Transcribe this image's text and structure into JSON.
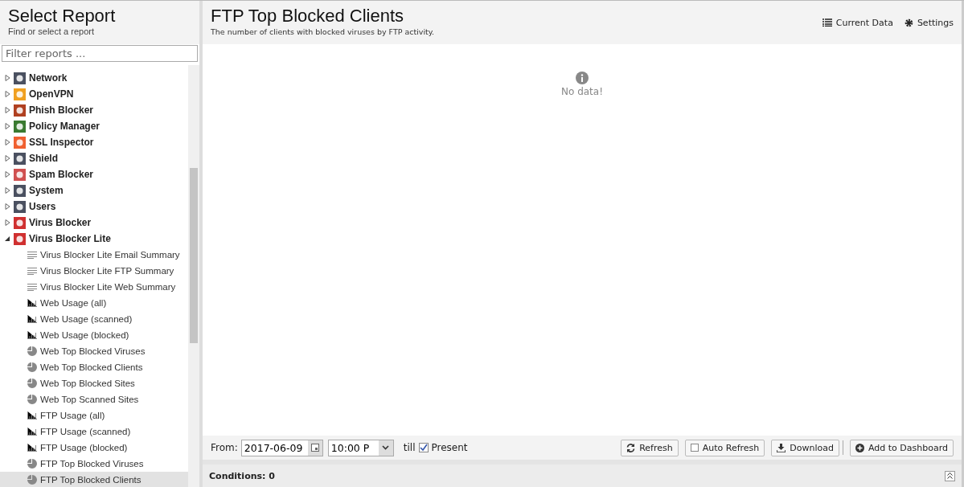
{
  "sidebar": {
    "title": "Select Report",
    "subtitle": "Find or select a report",
    "filter": {
      "placeholder": "Filter reports ..."
    },
    "tree": [
      {
        "label": "Network",
        "expanded": false,
        "color": "#4a5060"
      },
      {
        "label": "OpenVPN",
        "expanded": false,
        "color": "#f0a020"
      },
      {
        "label": "Phish Blocker",
        "expanded": false,
        "color": "#b04020"
      },
      {
        "label": "Policy Manager",
        "expanded": false,
        "color": "#3a7a30"
      },
      {
        "label": "SSL Inspector",
        "expanded": false,
        "color": "#f06030"
      },
      {
        "label": "Shield",
        "expanded": false,
        "color": "#4a5060"
      },
      {
        "label": "Spam Blocker",
        "expanded": false,
        "color": "#d05050"
      },
      {
        "label": "System",
        "expanded": false,
        "color": "#4a5060"
      },
      {
        "label": "Users",
        "expanded": false,
        "color": "#4a5060"
      },
      {
        "label": "Virus Blocker",
        "expanded": false,
        "color": "#d03030"
      },
      {
        "label": "Virus Blocker Lite",
        "expanded": true,
        "color": "#d03030",
        "children": [
          {
            "label": "Virus Blocker Lite Email Summary",
            "kind": "summary",
            "selected": false
          },
          {
            "label": "Virus Blocker Lite FTP Summary",
            "kind": "summary",
            "selected": false
          },
          {
            "label": "Virus Blocker Lite Web Summary",
            "kind": "summary",
            "selected": false
          },
          {
            "label": "Web Usage (all)",
            "kind": "bar",
            "selected": false
          },
          {
            "label": "Web Usage (scanned)",
            "kind": "bar",
            "selected": false
          },
          {
            "label": "Web Usage (blocked)",
            "kind": "bar",
            "selected": false
          },
          {
            "label": "Web Top Blocked Viruses",
            "kind": "pie",
            "selected": false
          },
          {
            "label": "Web Top Blocked Clients",
            "kind": "pie",
            "selected": false
          },
          {
            "label": "Web Top Blocked Sites",
            "kind": "pie",
            "selected": false
          },
          {
            "label": "Web Top Scanned Sites",
            "kind": "pie",
            "selected": false
          },
          {
            "label": "FTP Usage (all)",
            "kind": "bar",
            "selected": false
          },
          {
            "label": "FTP Usage (scanned)",
            "kind": "bar",
            "selected": false
          },
          {
            "label": "FTP Usage (blocked)",
            "kind": "bar",
            "selected": false
          },
          {
            "label": "FTP Top Blocked Viruses",
            "kind": "pie",
            "selected": false
          },
          {
            "label": "FTP Top Blocked Clients",
            "kind": "pie",
            "selected": true
          }
        ]
      }
    ]
  },
  "report": {
    "title": "FTP Top Blocked Clients",
    "description": "The number of clients with blocked viruses by FTP activity.",
    "actions": [
      "Current Data",
      "Settings"
    ],
    "message": "No data!"
  },
  "toolbar": {
    "from_label": "From:",
    "date": "2017-06-09",
    "time": "10:00 P",
    "till_label": "till",
    "present": {
      "label": "Present",
      "checked": true
    },
    "buttons": [
      {
        "label": "Refresh",
        "kind": "refresh"
      },
      {
        "label": "Auto Refresh",
        "kind": "toggle",
        "checked": false
      },
      {
        "label": "Download",
        "kind": "download"
      },
      {
        "label": "Add to Dashboard",
        "kind": "add"
      }
    ]
  },
  "conditions": {
    "label": "Conditions: 0"
  }
}
